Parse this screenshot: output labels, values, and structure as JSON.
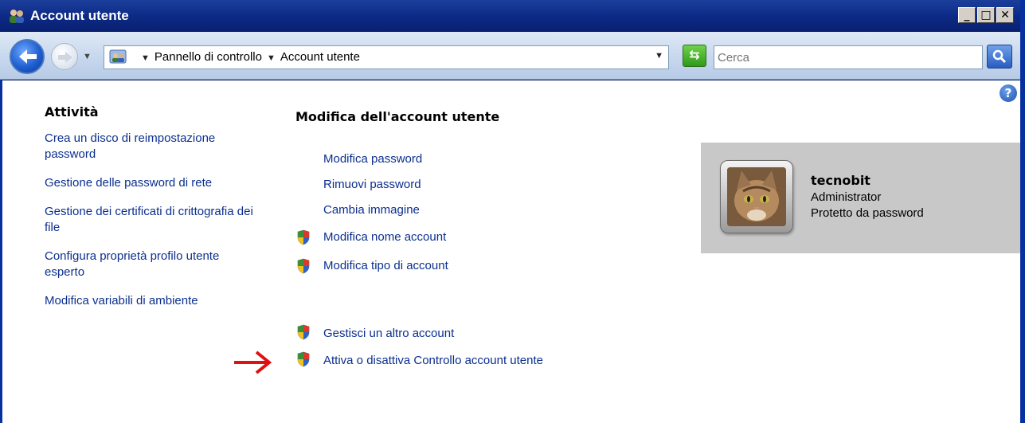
{
  "window": {
    "title": "Account utente",
    "title_icon": "users-icon",
    "buttons": {
      "minimize": "_",
      "maximize": "□",
      "close": "✕"
    }
  },
  "navbar": {
    "breadcrumbs": [
      "Pannello di controllo",
      "Account utente"
    ],
    "search": {
      "placeholder": "Cerca",
      "value": ""
    }
  },
  "tasks": {
    "title": "Attività",
    "items": [
      "Crea un disco di reimpostazione password",
      "Gestione delle password di rete",
      "Gestione dei certificati di crittografia dei file",
      "Configura proprietà profilo utente esperto",
      "Modifica variabili di ambiente"
    ]
  },
  "main": {
    "title": "Modifica dell'account utente",
    "links": [
      {
        "label": "Modifica password",
        "shield": false
      },
      {
        "label": "Rimuovi password",
        "shield": false
      },
      {
        "label": "Cambia immagine",
        "shield": false
      },
      {
        "label": "Modifica nome account",
        "shield": true
      },
      {
        "label": "Modifica tipo di account",
        "shield": true
      },
      {
        "label": "Gestisci un altro account",
        "shield": true
      },
      {
        "label": "Attiva o disattiva Controllo account utente",
        "shield": true
      }
    ]
  },
  "user": {
    "name": "tecnobit",
    "role": "Administrator",
    "status": "Protetto da password"
  },
  "colors": {
    "titlebar": "#0c2a86",
    "link": "#0b2f8f",
    "panel": "#c8c8c8",
    "arrow": "#e01010"
  }
}
